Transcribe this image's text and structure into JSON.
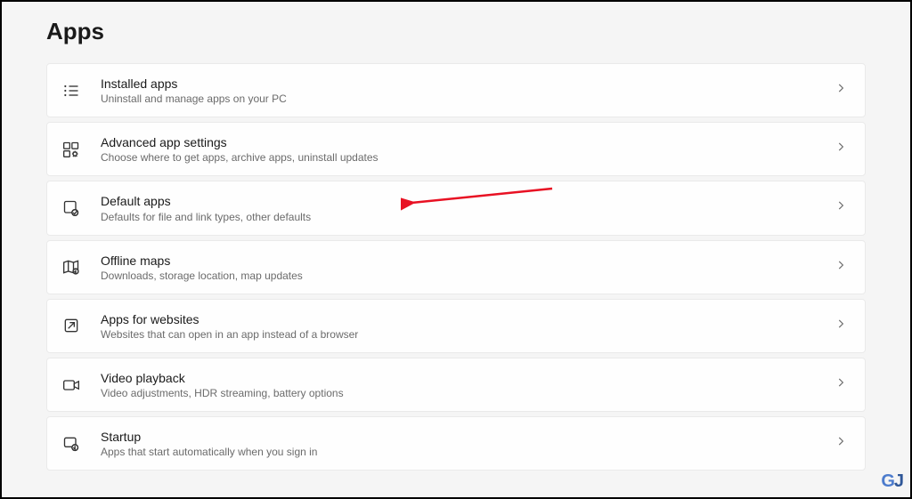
{
  "page_title": "Apps",
  "items": [
    {
      "title": "Installed apps",
      "desc": "Uninstall and manage apps on your PC"
    },
    {
      "title": "Advanced app settings",
      "desc": "Choose where to get apps, archive apps, uninstall updates"
    },
    {
      "title": "Default apps",
      "desc": "Defaults for file and link types, other defaults"
    },
    {
      "title": "Offline maps",
      "desc": "Downloads, storage location, map updates"
    },
    {
      "title": "Apps for websites",
      "desc": "Websites that can open in an app instead of a browser"
    },
    {
      "title": "Video playback",
      "desc": "Video adjustments, HDR streaming, battery options"
    },
    {
      "title": "Startup",
      "desc": "Apps that start automatically when you sign in"
    }
  ]
}
